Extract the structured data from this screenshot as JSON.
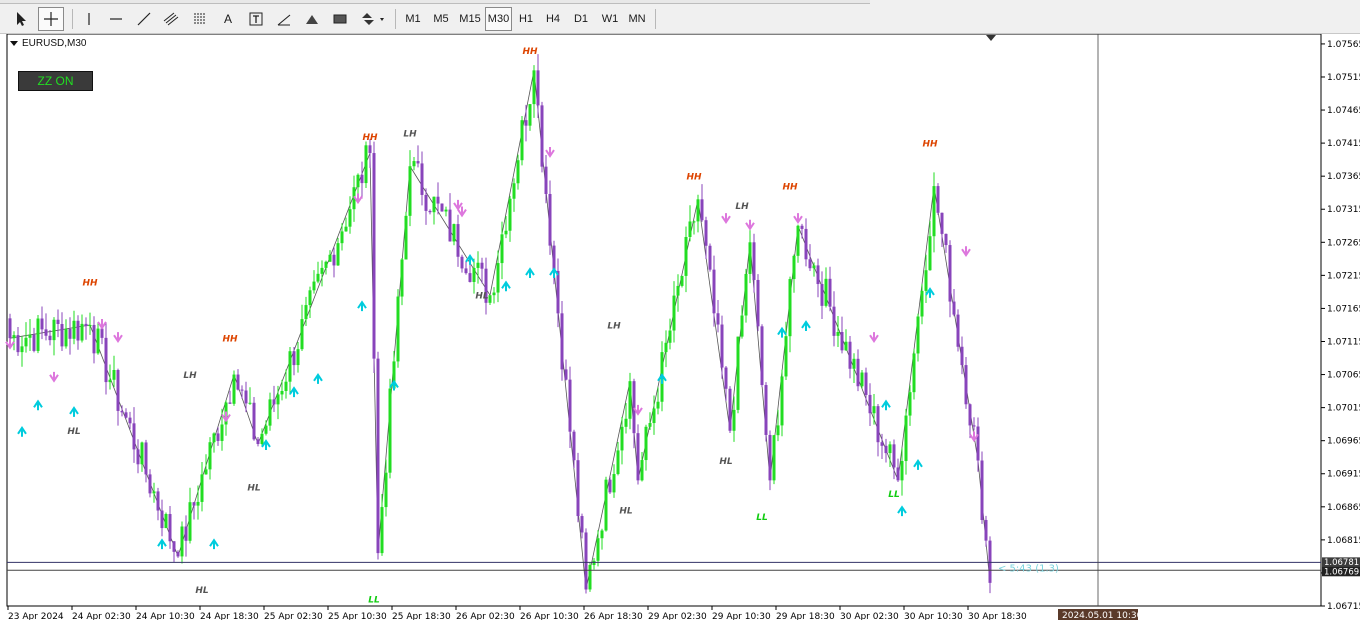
{
  "toolbar": {
    "timeframes": [
      "M1",
      "M5",
      "M15",
      "M30",
      "H1",
      "H4",
      "D1",
      "W1",
      "MN"
    ],
    "selected_timeframe": "M30"
  },
  "chart": {
    "symbol_label": "EURUSD,M30",
    "zz_button_label": "ZZ ON",
    "countdown_label": "< 5:43 (1.3)",
    "date_tooltip": "2024.05.01 10:30",
    "current_price": "1.06769",
    "prev_price": "1.06781",
    "colors": {
      "bull": "#22dd22",
      "bear": "#8844bb",
      "hh": "#dd4400",
      "ll": "#11cc11",
      "lh_hl": "#555555",
      "up_arrow": "#00ccdd",
      "down_arrow": "#dd77dd"
    }
  },
  "chart_data": {
    "type": "candlestick",
    "y_ticks": [
      "1.07565",
      "1.07515",
      "1.07465",
      "1.07415",
      "1.07365",
      "1.07315",
      "1.07265",
      "1.07215",
      "1.07165",
      "1.07115",
      "1.07065",
      "1.07015",
      "1.06965",
      "1.06915",
      "1.06865",
      "1.06815",
      "1.06765",
      "1.06715"
    ],
    "ylim": [
      1.06715,
      1.0758
    ],
    "x_ticks": [
      "23 Apr 2024",
      "24 Apr 02:30",
      "24 Apr 10:30",
      "24 Apr 18:30",
      "25 Apr 02:30",
      "25 Apr 10:30",
      "25 Apr 18:30",
      "26 Apr 02:30",
      "26 Apr 10:30",
      "26 Apr 18:30",
      "29 Apr 02:30",
      "29 Apr 10:30",
      "29 Apr 18:30",
      "30 Apr 02:30",
      "30 Apr 10:30",
      "30 Apr 18:30"
    ],
    "zigzag": [
      {
        "i": 0,
        "p": 1.0712
      },
      {
        "i": 20,
        "p": 1.0714
      },
      {
        "i": 42,
        "p": 1.0679
      },
      {
        "i": 56,
        "p": 1.07065
      },
      {
        "i": 62,
        "p": 1.0696
      },
      {
        "i": 90,
        "p": 1.074
      },
      {
        "i": 92,
        "p": 1.06795
      },
      {
        "i": 100,
        "p": 1.0738
      },
      {
        "i": 120,
        "p": 1.07185
      },
      {
        "i": 131,
        "p": 1.07525
      },
      {
        "i": 144,
        "p": 1.0674
      },
      {
        "i": 155,
        "p": 1.07055
      },
      {
        "i": 157,
        "p": 1.06905
      },
      {
        "i": 172,
        "p": 1.0733
      },
      {
        "i": 180,
        "p": 1.0698
      },
      {
        "i": 185,
        "p": 1.07265
      },
      {
        "i": 190,
        "p": 1.06905
      },
      {
        "i": 197,
        "p": 1.0729
      },
      {
        "i": 222,
        "p": 1.06905
      },
      {
        "i": 231,
        "p": 1.0735
      },
      {
        "i": 242,
        "p": 1.06935
      },
      {
        "i": 245,
        "p": 1.0675
      }
    ],
    "labels": [
      {
        "text": "HH",
        "i": 20,
        "p": 1.072,
        "kind": "hh"
      },
      {
        "text": "HL",
        "i": 16,
        "p": 1.06975,
        "kind": "lh"
      },
      {
        "text": "LH",
        "i": 45,
        "p": 1.0706,
        "kind": "lh"
      },
      {
        "text": "HL",
        "i": 48,
        "p": 1.06735,
        "kind": "lh"
      },
      {
        "text": "HH",
        "i": 55,
        "p": 1.07115,
        "kind": "hh"
      },
      {
        "text": "HL",
        "i": 61,
        "p": 1.0689,
        "kind": "lh"
      },
      {
        "text": "HH",
        "i": 90,
        "p": 1.0742,
        "kind": "hh"
      },
      {
        "text": "LL",
        "i": 91,
        "p": 1.0672,
        "kind": "ll"
      },
      {
        "text": "LH",
        "i": 100,
        "p": 1.07425,
        "kind": "lh"
      },
      {
        "text": "HL",
        "i": 118,
        "p": 1.0718,
        "kind": "lh"
      },
      {
        "text": "HH",
        "i": 130,
        "p": 1.0755,
        "kind": "hh"
      },
      {
        "text": "LH",
        "i": 151,
        "p": 1.07135,
        "kind": "lh"
      },
      {
        "text": "HL",
        "i": 154,
        "p": 1.06855,
        "kind": "lh"
      },
      {
        "text": "HH",
        "i": 171,
        "p": 1.0736,
        "kind": "hh"
      },
      {
        "text": "LH",
        "i": 183,
        "p": 1.07315,
        "kind": "lh"
      },
      {
        "text": "HL",
        "i": 179,
        "p": 1.0693,
        "kind": "lh"
      },
      {
        "text": "LL",
        "i": 188,
        "p": 1.06845,
        "kind": "ll"
      },
      {
        "text": "HH",
        "i": 195,
        "p": 1.07345,
        "kind": "hh"
      },
      {
        "text": "LL",
        "i": 221,
        "p": 1.0688,
        "kind": "ll"
      },
      {
        "text": "HH",
        "i": 230,
        "p": 1.0741,
        "kind": "hh"
      }
    ],
    "up_arrows": [
      [
        3,
        1.0698
      ],
      [
        7,
        1.0702
      ],
      [
        16,
        1.0701
      ],
      [
        38,
        1.0681
      ],
      [
        51,
        1.0681
      ],
      [
        64,
        1.0696
      ],
      [
        71,
        1.0704
      ],
      [
        77,
        1.0706
      ],
      [
        88,
        1.0717
      ],
      [
        96,
        1.0705
      ],
      [
        115,
        1.0724
      ],
      [
        124,
        1.072
      ],
      [
        130,
        1.0722
      ],
      [
        136,
        1.0722
      ],
      [
        163,
        1.0706
      ],
      [
        193,
        1.0713
      ],
      [
        199,
        1.0714
      ],
      [
        219,
        1.0702
      ],
      [
        223,
        1.0686
      ],
      [
        227,
        1.0693
      ],
      [
        230,
        1.0719
      ]
    ],
    "down_arrows": [
      [
        0,
        1.0711
      ],
      [
        11,
        1.0706
      ],
      [
        23,
        1.0714
      ],
      [
        27,
        1.0712
      ],
      [
        54,
        1.07
      ],
      [
        87,
        1.0733
      ],
      [
        112,
        1.0732
      ],
      [
        113,
        1.0731
      ],
      [
        135,
        1.074
      ],
      [
        157,
        1.0701
      ],
      [
        179,
        1.073
      ],
      [
        185,
        1.0729
      ],
      [
        197,
        1.073
      ],
      [
        216,
        1.0712
      ],
      [
        239,
        1.0725
      ],
      [
        241,
        1.0697
      ]
    ]
  }
}
